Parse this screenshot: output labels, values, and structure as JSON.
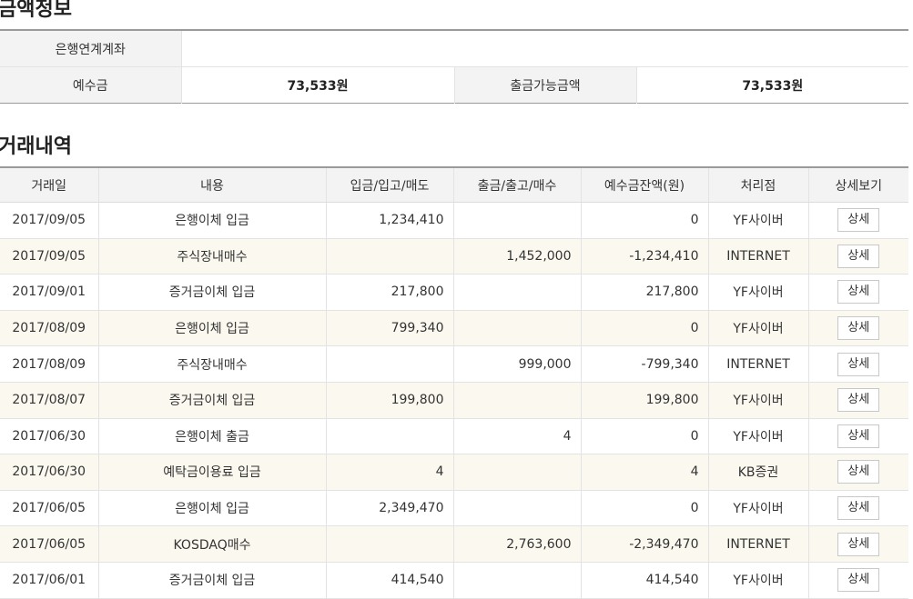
{
  "amount_section": {
    "title": "금액정보",
    "linked_account_label": "은행연계계좌",
    "linked_account_value": "",
    "deposit_label": "예수금",
    "deposit_value": "73,533원",
    "withdrawable_label": "출금가능금액",
    "withdrawable_value": "73,533원"
  },
  "history_section": {
    "title": "거래내역",
    "columns": [
      "거래일",
      "내용",
      "입금/입고/매도",
      "출금/출고/매수",
      "예수금잔액(원)",
      "처리점",
      "상세보기"
    ],
    "detail_label": "상세",
    "rows": [
      {
        "date": "2017/09/05",
        "desc": "은행이체 입금",
        "in": "1,234,410",
        "out": "",
        "balance": "0",
        "branch": "YF사이버"
      },
      {
        "date": "2017/09/05",
        "desc": "주식장내매수",
        "in": "",
        "out": "1,452,000",
        "balance": "-1,234,410",
        "branch": "INTERNET"
      },
      {
        "date": "2017/09/01",
        "desc": "증거금이체 입금",
        "in": "217,800",
        "out": "",
        "balance": "217,800",
        "branch": "YF사이버"
      },
      {
        "date": "2017/08/09",
        "desc": "은행이체 입금",
        "in": "799,340",
        "out": "",
        "balance": "0",
        "branch": "YF사이버"
      },
      {
        "date": "2017/08/09",
        "desc": "주식장내매수",
        "in": "",
        "out": "999,000",
        "balance": "-799,340",
        "branch": "INTERNET"
      },
      {
        "date": "2017/08/07",
        "desc": "증거금이체 입금",
        "in": "199,800",
        "out": "",
        "balance": "199,800",
        "branch": "YF사이버"
      },
      {
        "date": "2017/06/30",
        "desc": "은행이체 출금",
        "in": "",
        "out": "4",
        "balance": "0",
        "branch": "YF사이버"
      },
      {
        "date": "2017/06/30",
        "desc": "예탁금이용료 입금",
        "in": "4",
        "out": "",
        "balance": "4",
        "branch": "KB증권"
      },
      {
        "date": "2017/06/05",
        "desc": "은행이체 입금",
        "in": "2,349,470",
        "out": "",
        "balance": "0",
        "branch": "YF사이버"
      },
      {
        "date": "2017/06/05",
        "desc": "KOSDAQ매수",
        "in": "",
        "out": "2,763,600",
        "balance": "-2,349,470",
        "branch": "INTERNET"
      },
      {
        "date": "2017/06/01",
        "desc": "증거금이체 입금",
        "in": "414,540",
        "out": "",
        "balance": "414,540",
        "branch": "YF사이버"
      }
    ]
  }
}
